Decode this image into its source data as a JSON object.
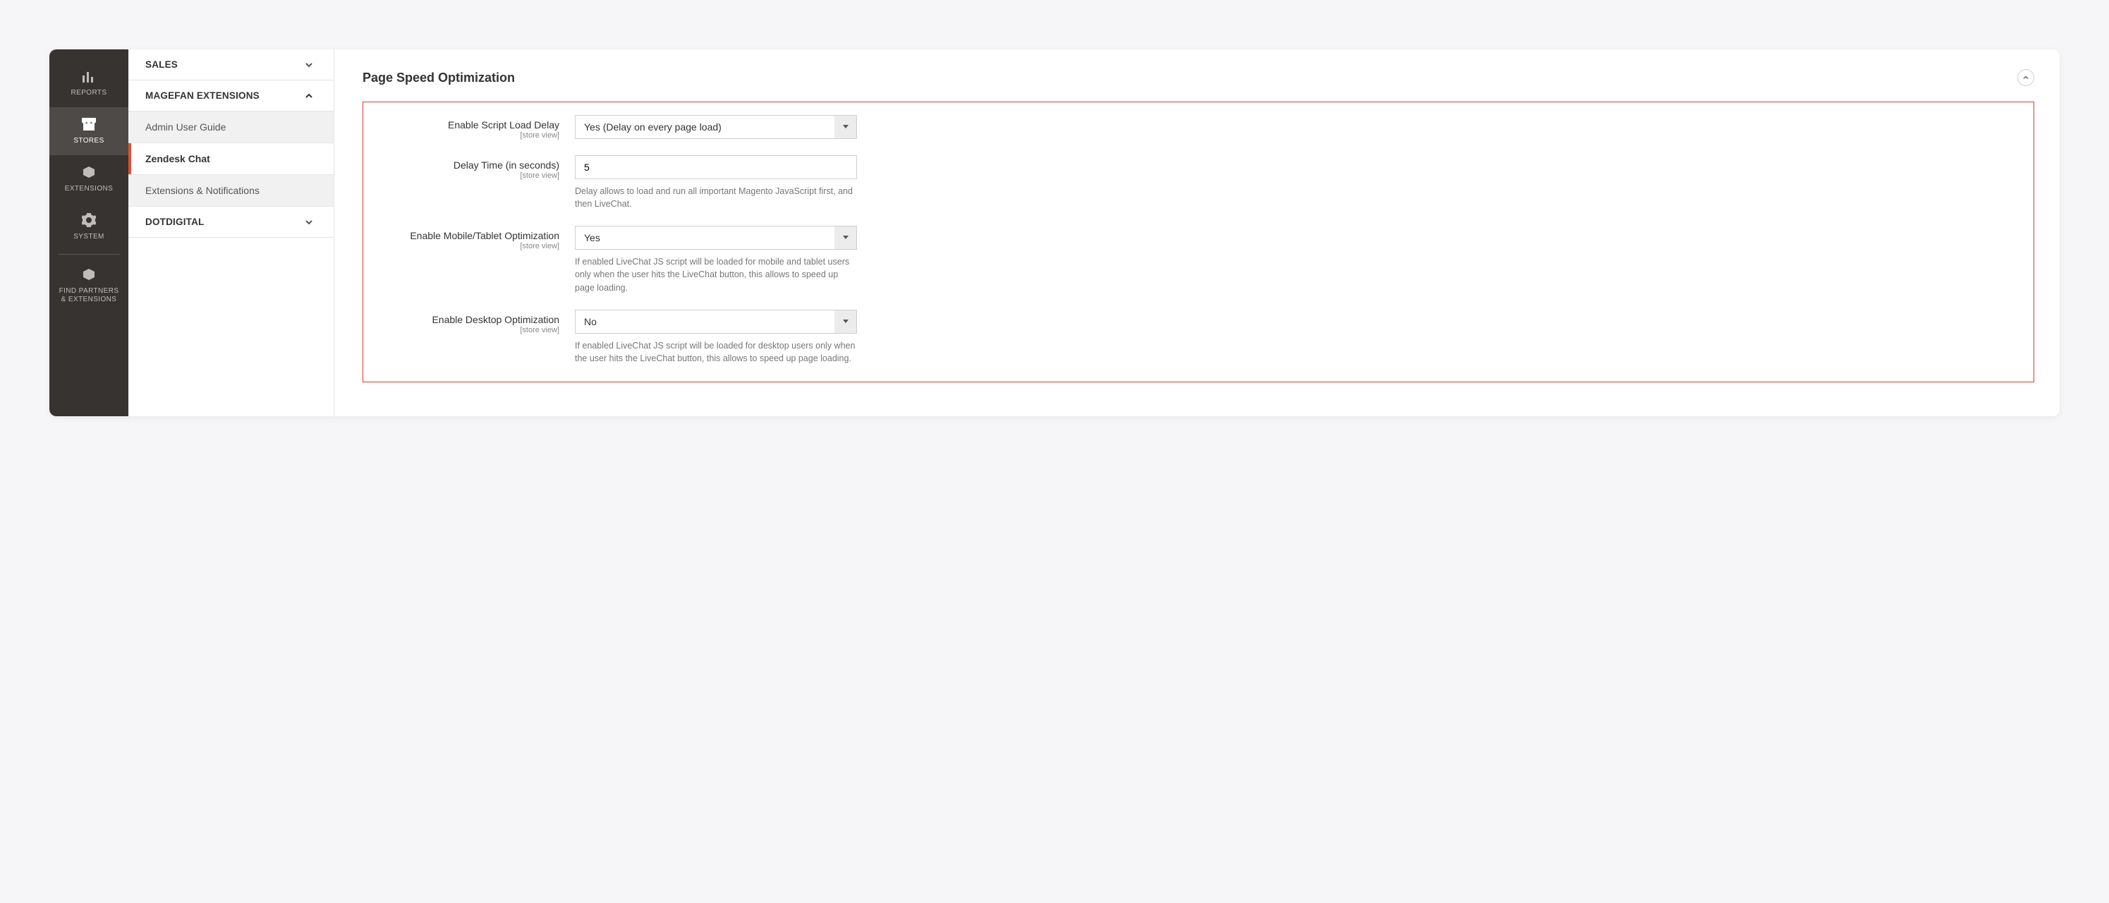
{
  "adminNav": [
    {
      "key": "reports",
      "label": "REPORTS"
    },
    {
      "key": "stores",
      "label": "STORES",
      "active": true
    },
    {
      "key": "extensions",
      "label": "EXTENSIONS"
    },
    {
      "key": "system",
      "label": "SYSTEM"
    },
    {
      "key": "partners",
      "label": "FIND PARTNERS\n& EXTENSIONS"
    }
  ],
  "tree": {
    "sales": "SALES",
    "magefan": "MAGEFAN EXTENSIONS",
    "items": [
      "Admin User Guide",
      "Zendesk Chat",
      "Extensions & Notifications"
    ],
    "dotdigital": "DOTDIGITAL"
  },
  "main": {
    "section_title": "Page Speed Optimization",
    "scope_text": "[store view]",
    "fields": {
      "script_delay": {
        "label": "Enable Script Load Delay",
        "value": "Yes (Delay on every page load)"
      },
      "delay_time": {
        "label": "Delay Time (in seconds)",
        "value": "5",
        "help": "Delay allows to load and run all important Magento JavaScript first, and then LiveChat."
      },
      "mobile_opt": {
        "label": "Enable Mobile/Tablet Optimization",
        "value": "Yes",
        "help": "If enabled LiveChat JS script will be loaded for mobile and tablet users only when the user hits the LiveChat button, this allows to speed up page loading."
      },
      "desktop_opt": {
        "label": "Enable Desktop Optimization",
        "value": "No",
        "help": "If enabled LiveChat JS script will be loaded for desktop users only when the user hits the LiveChat button, this allows to speed up page loading."
      }
    }
  }
}
